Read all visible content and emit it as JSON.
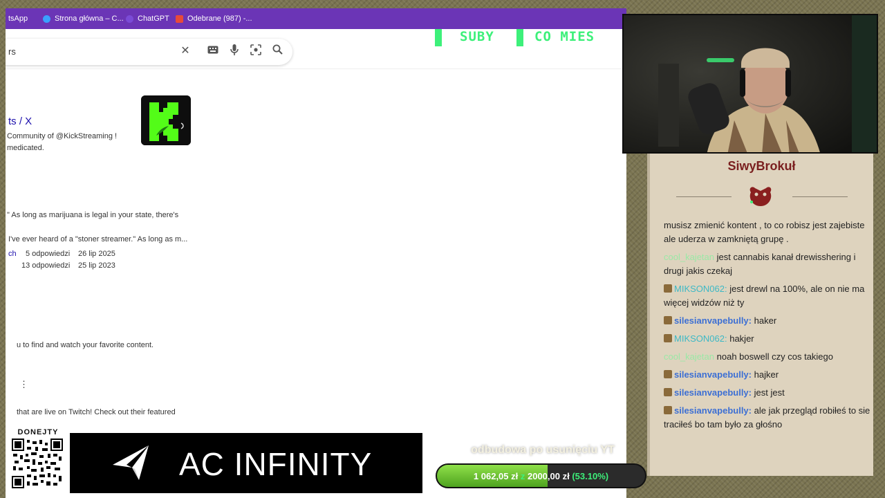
{
  "browser": {
    "tabs": [
      {
        "label": "tsApp",
        "color": "#25d366"
      },
      {
        "label": "Strona główna – C...",
        "color": "#3aa0ff"
      },
      {
        "label": "ChatGPT",
        "color": "#7b4bd6"
      },
      {
        "label": "Odebrane (987) -...",
        "color": "#e84a3a"
      }
    ],
    "search": {
      "value": "rs"
    },
    "result": {
      "title": "ts / X",
      "line1": "Community of @KickStreaming !",
      "line2": "medicated."
    },
    "snippets": {
      "s1_pre": "\" As long as ",
      "s1_bold": "marijuana",
      "s1_post": " is legal in your state, there's",
      "s2": "I've ever heard of a \"stoner streamer.\" As long as m...",
      "r1_link": "ch",
      "r1_replies": "5 odpowiedzi",
      "r1_date": "26 lip 2025",
      "r2_replies": "13 odpowiedzi",
      "r2_date": "25 lip 2023",
      "s3": "u to find and watch your favorite content.",
      "s4": "that are live on Twitch! Check out their featured"
    }
  },
  "overlay": {
    "subs_label": "SUBY",
    "monthly_label": "CO MIES",
    "accent": "#3df07a"
  },
  "chat": {
    "streamer": "SiwyBrokuł",
    "messages": [
      {
        "user": "",
        "text": "musisz zmienić kontent , to co robisz jest zajebiste ale uderza w zamkniętą grupę .",
        "color": "#222222",
        "badge": false
      },
      {
        "user": "cool_kajetan",
        "text": "jest cannabis kanał drewisshering i drugi jakis czekaj",
        "color": "#9be8a6",
        "badge": false
      },
      {
        "user": "MIKSON062:",
        "text": "jest drewl na 100%, ale on nie ma więcej widzów niż ty",
        "color": "#3cb9c6",
        "badge": true
      },
      {
        "user": "silesianvapebully:",
        "text": "haker",
        "color": "#3c6fd4",
        "badge": true
      },
      {
        "user": "MIKSON062:",
        "text": "hakjer",
        "color": "#3cb9c6",
        "badge": true
      },
      {
        "user": "cool_kajetan",
        "text": "noah boswell czy cos takiego",
        "color": "#9be8a6",
        "badge": false
      },
      {
        "user": "silesianvapebully:",
        "text": "hajker",
        "color": "#3c6fd4",
        "badge": true
      },
      {
        "user": "silesianvapebully:",
        "text": "jest jest",
        "color": "#3c6fd4",
        "badge": true
      },
      {
        "user": "silesianvapebully:",
        "text": "ale jak przegląd robiłeś to sie traciłeś bo tam było za głośno",
        "color": "#3c6fd4",
        "badge": true
      }
    ]
  },
  "donations": {
    "qr_label": "DONEJTY",
    "sponsor": "AC INFINITY",
    "goal_title": "odbudowa po usunięciu YT",
    "current": "1 062,05 zł",
    "of_word": "z",
    "target": "2000,00 zł",
    "percent_text": "(53.10%)",
    "progress": 0.531
  }
}
